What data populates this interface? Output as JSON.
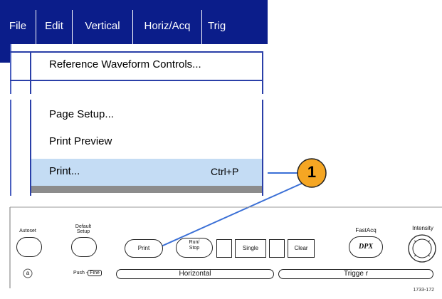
{
  "menubar": {
    "items": [
      {
        "label": "File"
      },
      {
        "label": "Edit"
      },
      {
        "label": "Vertical"
      },
      {
        "label": "Horiz/Acq"
      },
      {
        "label": "Trig"
      }
    ]
  },
  "menu": {
    "reference_item": "Reference Waveform Controls...",
    "page_setup": "Page Setup...",
    "print_preview": "Print Preview",
    "print": "Print...",
    "print_shortcut": "Ctrl+P"
  },
  "callout": {
    "number": "1"
  },
  "front_panel": {
    "autoset": "Autoset",
    "default_setup_line1": "Default",
    "default_setup_line2": "Setup",
    "print": "Print",
    "run_stop_line1": "Run/",
    "run_stop_line2": "Stop",
    "single": "Single",
    "clear": "Clear",
    "fastacq": "FastAcq",
    "dpx": "DPX",
    "intensity": "Intensity",
    "push_prefix": "Push -",
    "push_fine": "Fine",
    "horizontal": "Horizontal",
    "trigger": "Trigge r",
    "a_knob": "a"
  },
  "figure_id": "1733-172",
  "colors": {
    "menubar_bg": "#0b1d8a",
    "highlight": "#c4dcf4",
    "callout_fill": "#f5a623",
    "arrow_line": "#3a6fd6"
  }
}
